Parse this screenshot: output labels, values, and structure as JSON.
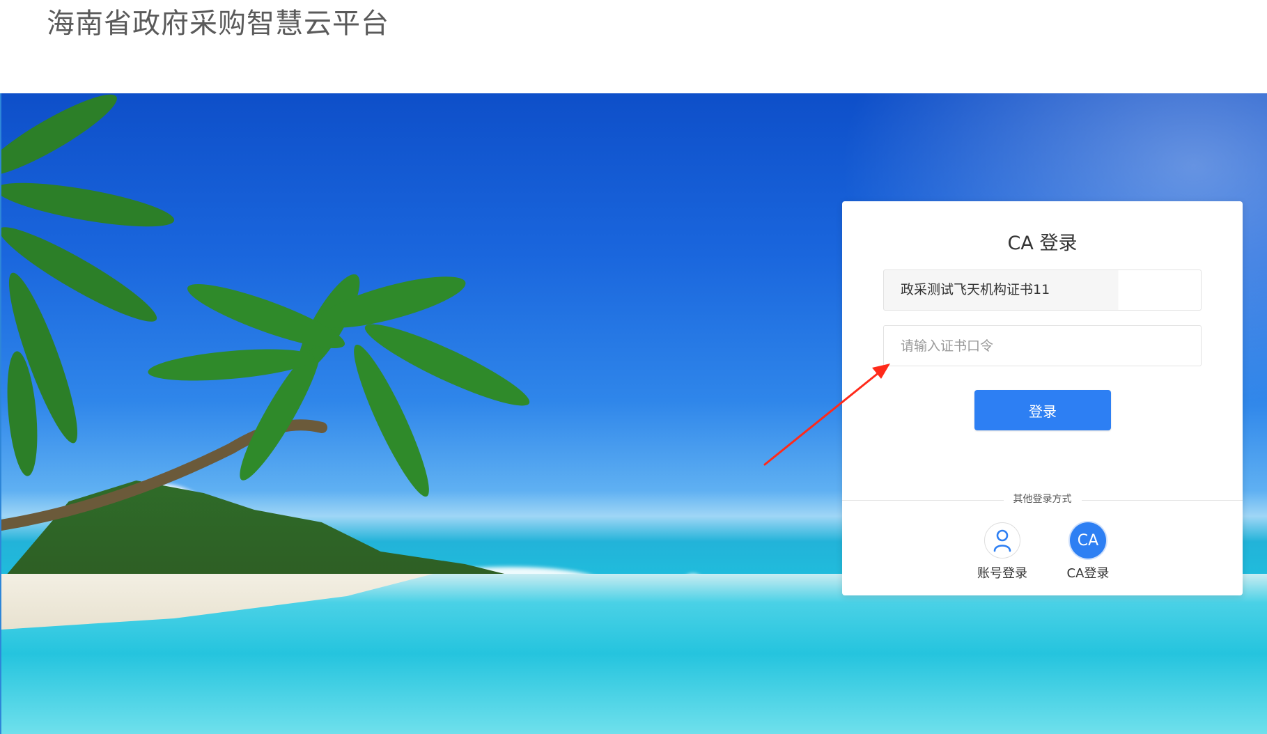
{
  "header": {
    "site_title": "海南省政府采购智慧云平台"
  },
  "login": {
    "title": "CA 登录",
    "certificate_name": "政采测试飞天机构证书11",
    "password_placeholder": "请输入证书口令",
    "submit_label": "登录"
  },
  "other_methods": {
    "divider_label": "其他登录方式",
    "options": [
      {
        "label": "账号登录",
        "icon": "user-icon"
      },
      {
        "label": "CA登录",
        "icon": "ca-badge-icon",
        "icon_text": "CA",
        "active": true
      }
    ]
  },
  "colors": {
    "primary": "#2d7ff3",
    "annotation_arrow": "#ff2a1a"
  }
}
